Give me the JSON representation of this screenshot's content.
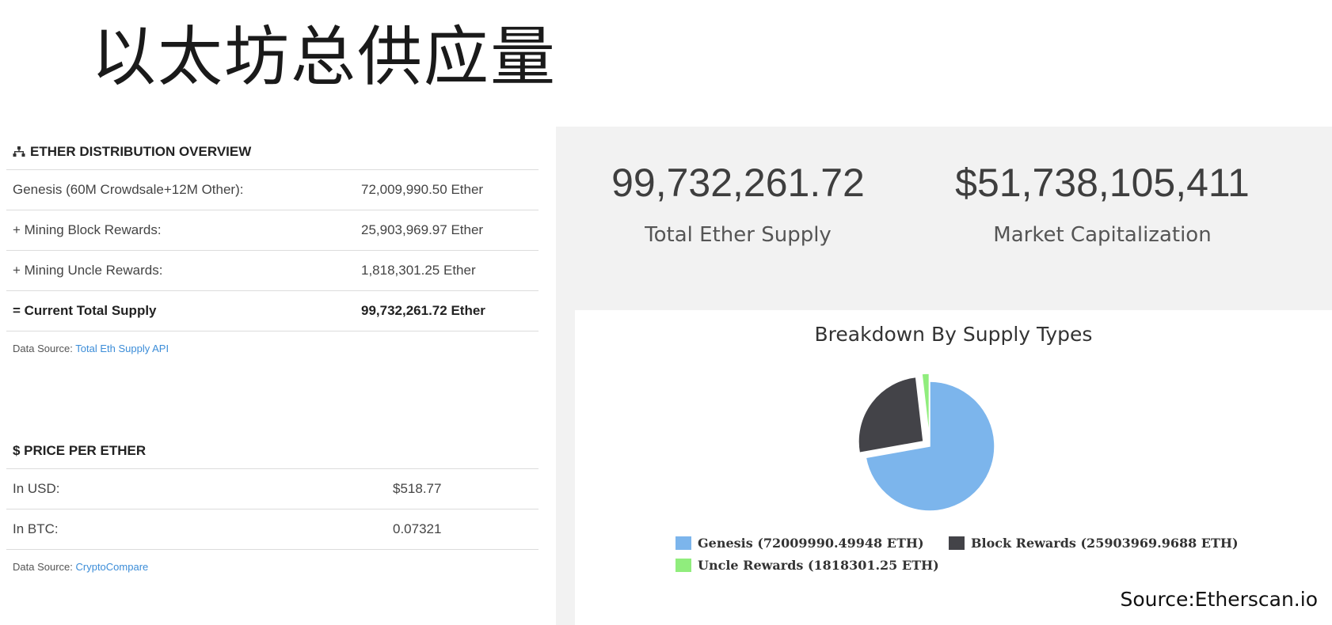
{
  "page": {
    "title": "以太坊总供应量"
  },
  "distribution": {
    "heading": "ETHER DISTRIBUTION OVERVIEW",
    "rows": [
      {
        "label": "Genesis (60M Crowdsale+12M Other):",
        "value": "72,009,990.50 Ether"
      },
      {
        "label": "+ Mining Block Rewards:",
        "value": "25,903,969.97 Ether"
      },
      {
        "label": "+ Mining Uncle Rewards:",
        "value": "1,818,301.25 Ether"
      },
      {
        "label": "= Current Total Supply",
        "value": "99,732,261.72 Ether"
      }
    ],
    "source_prefix": "Data Source:",
    "source_link": "Total Eth Supply API"
  },
  "price": {
    "heading": "$ PRICE PER ETHER",
    "rows": [
      {
        "label": "In USD:",
        "value": "$518.77"
      },
      {
        "label": "In BTC:",
        "value": "0.07321"
      }
    ],
    "source_prefix": "Data Source:",
    "source_link": "CryptoCompare"
  },
  "stats": {
    "supply_value": "99,732,261.72",
    "supply_label": "Total Ether Supply",
    "market_cap_value": "$51,738,105,411",
    "market_cap_label": "Market Capitalization"
  },
  "chart_data": {
    "type": "pie",
    "title": "Breakdown By Supply Types",
    "slices": [
      {
        "name": "Genesis (72009990.49948 ETH)",
        "value": 72009990.49948,
        "color": "#7cb5ec",
        "exploded": false
      },
      {
        "name": "Block Rewards (25903969.9688 ETH)",
        "value": 25903969.9688,
        "color": "#434348",
        "exploded": true
      },
      {
        "name": "Uncle Rewards (1818301.25 ETH)",
        "value": 1818301.25,
        "color": "#90ed7d",
        "exploded": true
      }
    ]
  },
  "credit": "Source:Etherscan.io",
  "icons": {
    "distribution": "sitemap-icon"
  }
}
